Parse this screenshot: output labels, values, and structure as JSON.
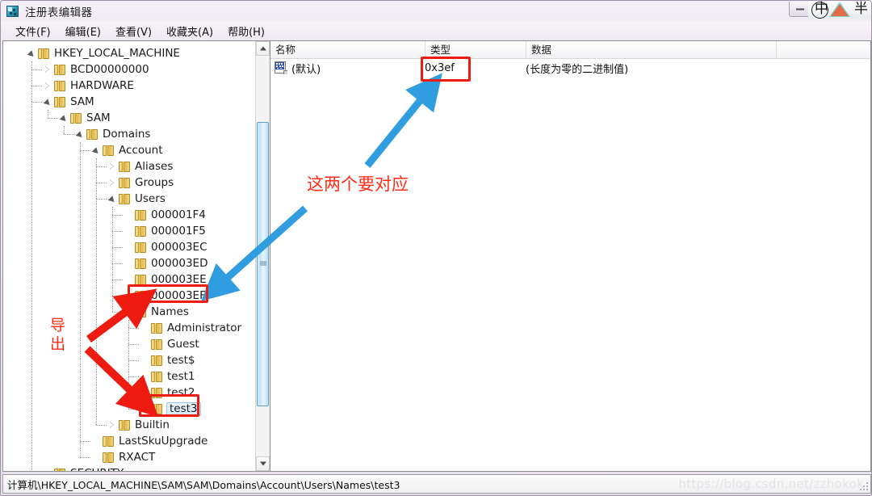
{
  "window": {
    "title": "注册表编辑器",
    "icon": "registry-editor-icon",
    "buttons": {
      "minimize": "–",
      "maximize": "□",
      "close": "✕"
    }
  },
  "ime": {
    "mode": "中",
    "width_mode": "半"
  },
  "menu": [
    {
      "label": "文件(F)"
    },
    {
      "label": "编辑(E)"
    },
    {
      "label": "查看(V)"
    },
    {
      "label": "收藏夹(A)"
    },
    {
      "label": "帮助(H)"
    }
  ],
  "tree": {
    "nodes": [
      {
        "label": "HKEY_LOCAL_MACHINE",
        "depth": 0,
        "state": "expanded"
      },
      {
        "label": "BCD00000000",
        "depth": 1,
        "state": "collapsed"
      },
      {
        "label": "HARDWARE",
        "depth": 1,
        "state": "collapsed"
      },
      {
        "label": "SAM",
        "depth": 1,
        "state": "expanded"
      },
      {
        "label": "SAM",
        "depth": 2,
        "state": "expanded"
      },
      {
        "label": "Domains",
        "depth": 3,
        "state": "expanded"
      },
      {
        "label": "Account",
        "depth": 4,
        "state": "expanded"
      },
      {
        "label": "Aliases",
        "depth": 5,
        "state": "collapsed"
      },
      {
        "label": "Groups",
        "depth": 5,
        "state": "collapsed"
      },
      {
        "label": "Users",
        "depth": 5,
        "state": "expanded"
      },
      {
        "label": "000001F4",
        "depth": 6,
        "state": "leaf"
      },
      {
        "label": "000001F5",
        "depth": 6,
        "state": "leaf"
      },
      {
        "label": "000003EC",
        "depth": 6,
        "state": "leaf"
      },
      {
        "label": "000003ED",
        "depth": 6,
        "state": "leaf"
      },
      {
        "label": "000003EE",
        "depth": 6,
        "state": "leaf"
      },
      {
        "label": "000003EF",
        "depth": 6,
        "state": "leaf"
      },
      {
        "label": "Names",
        "depth": 6,
        "state": "expanded"
      },
      {
        "label": "Administrator",
        "depth": 7,
        "state": "leaf"
      },
      {
        "label": "Guest",
        "depth": 7,
        "state": "leaf"
      },
      {
        "label": "test$",
        "depth": 7,
        "state": "leaf"
      },
      {
        "label": "test1",
        "depth": 7,
        "state": "leaf"
      },
      {
        "label": "test2",
        "depth": 7,
        "state": "leaf"
      },
      {
        "label": "test3",
        "depth": 7,
        "state": "leaf",
        "selected": true
      },
      {
        "label": "Builtin",
        "depth": 5,
        "state": "collapsed"
      },
      {
        "label": "LastSkuUpgrade",
        "depth": 4,
        "state": "leaf"
      },
      {
        "label": "RXACT",
        "depth": 4,
        "state": "leaf"
      },
      {
        "label": "SECURITY",
        "depth": 1,
        "state": "leaf"
      }
    ]
  },
  "list": {
    "columns": [
      {
        "label": "名称"
      },
      {
        "label": "类型"
      },
      {
        "label": "数据"
      },
      {
        "label": ""
      }
    ],
    "rows": [
      {
        "name": "(默认)",
        "type": "0x3ef",
        "data": "(长度为零的二进制值)",
        "icon": "binary-value-icon"
      }
    ]
  },
  "status": {
    "path": "计算机\\HKEY_LOCAL_MACHINE\\SAM\\SAM\\Domains\\Account\\Users\\Names\\test3",
    "watermark": "https://blog.csdn.net/zzhokok"
  },
  "annotations": {
    "correspond_note": "这两个要对应",
    "export_note": "导出",
    "export_note_chars": [
      "导",
      "出"
    ],
    "colors": {
      "red": "#ee1b11",
      "blue": "#2f9de0",
      "red_text": "#ff2d18"
    }
  }
}
